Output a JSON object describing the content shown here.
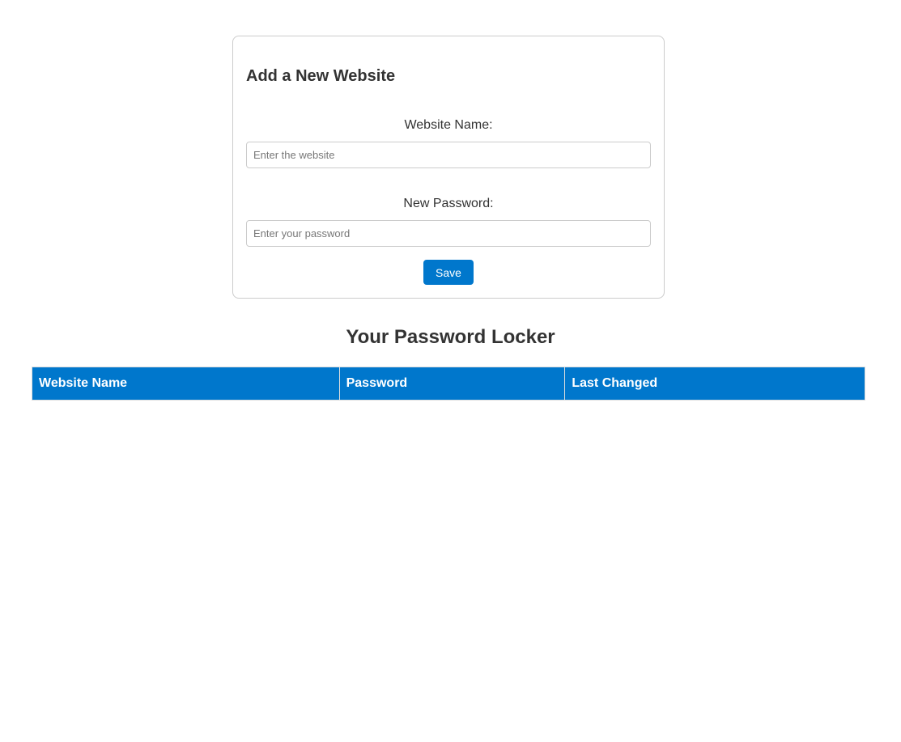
{
  "add_form": {
    "title": "Add a New Website",
    "website_label": "Website Name:",
    "website_placeholder": "Enter the website",
    "website_value": "",
    "password_label": "New Password:",
    "password_placeholder": "Enter your password",
    "password_value": "",
    "save_label": "Save"
  },
  "locker": {
    "title": "Your Password Locker",
    "columns": [
      "Website Name",
      "Password",
      "Last Changed"
    ],
    "rows": []
  },
  "colors": {
    "accent": "#0077cc",
    "text": "#333333",
    "border": "#cccccc"
  }
}
